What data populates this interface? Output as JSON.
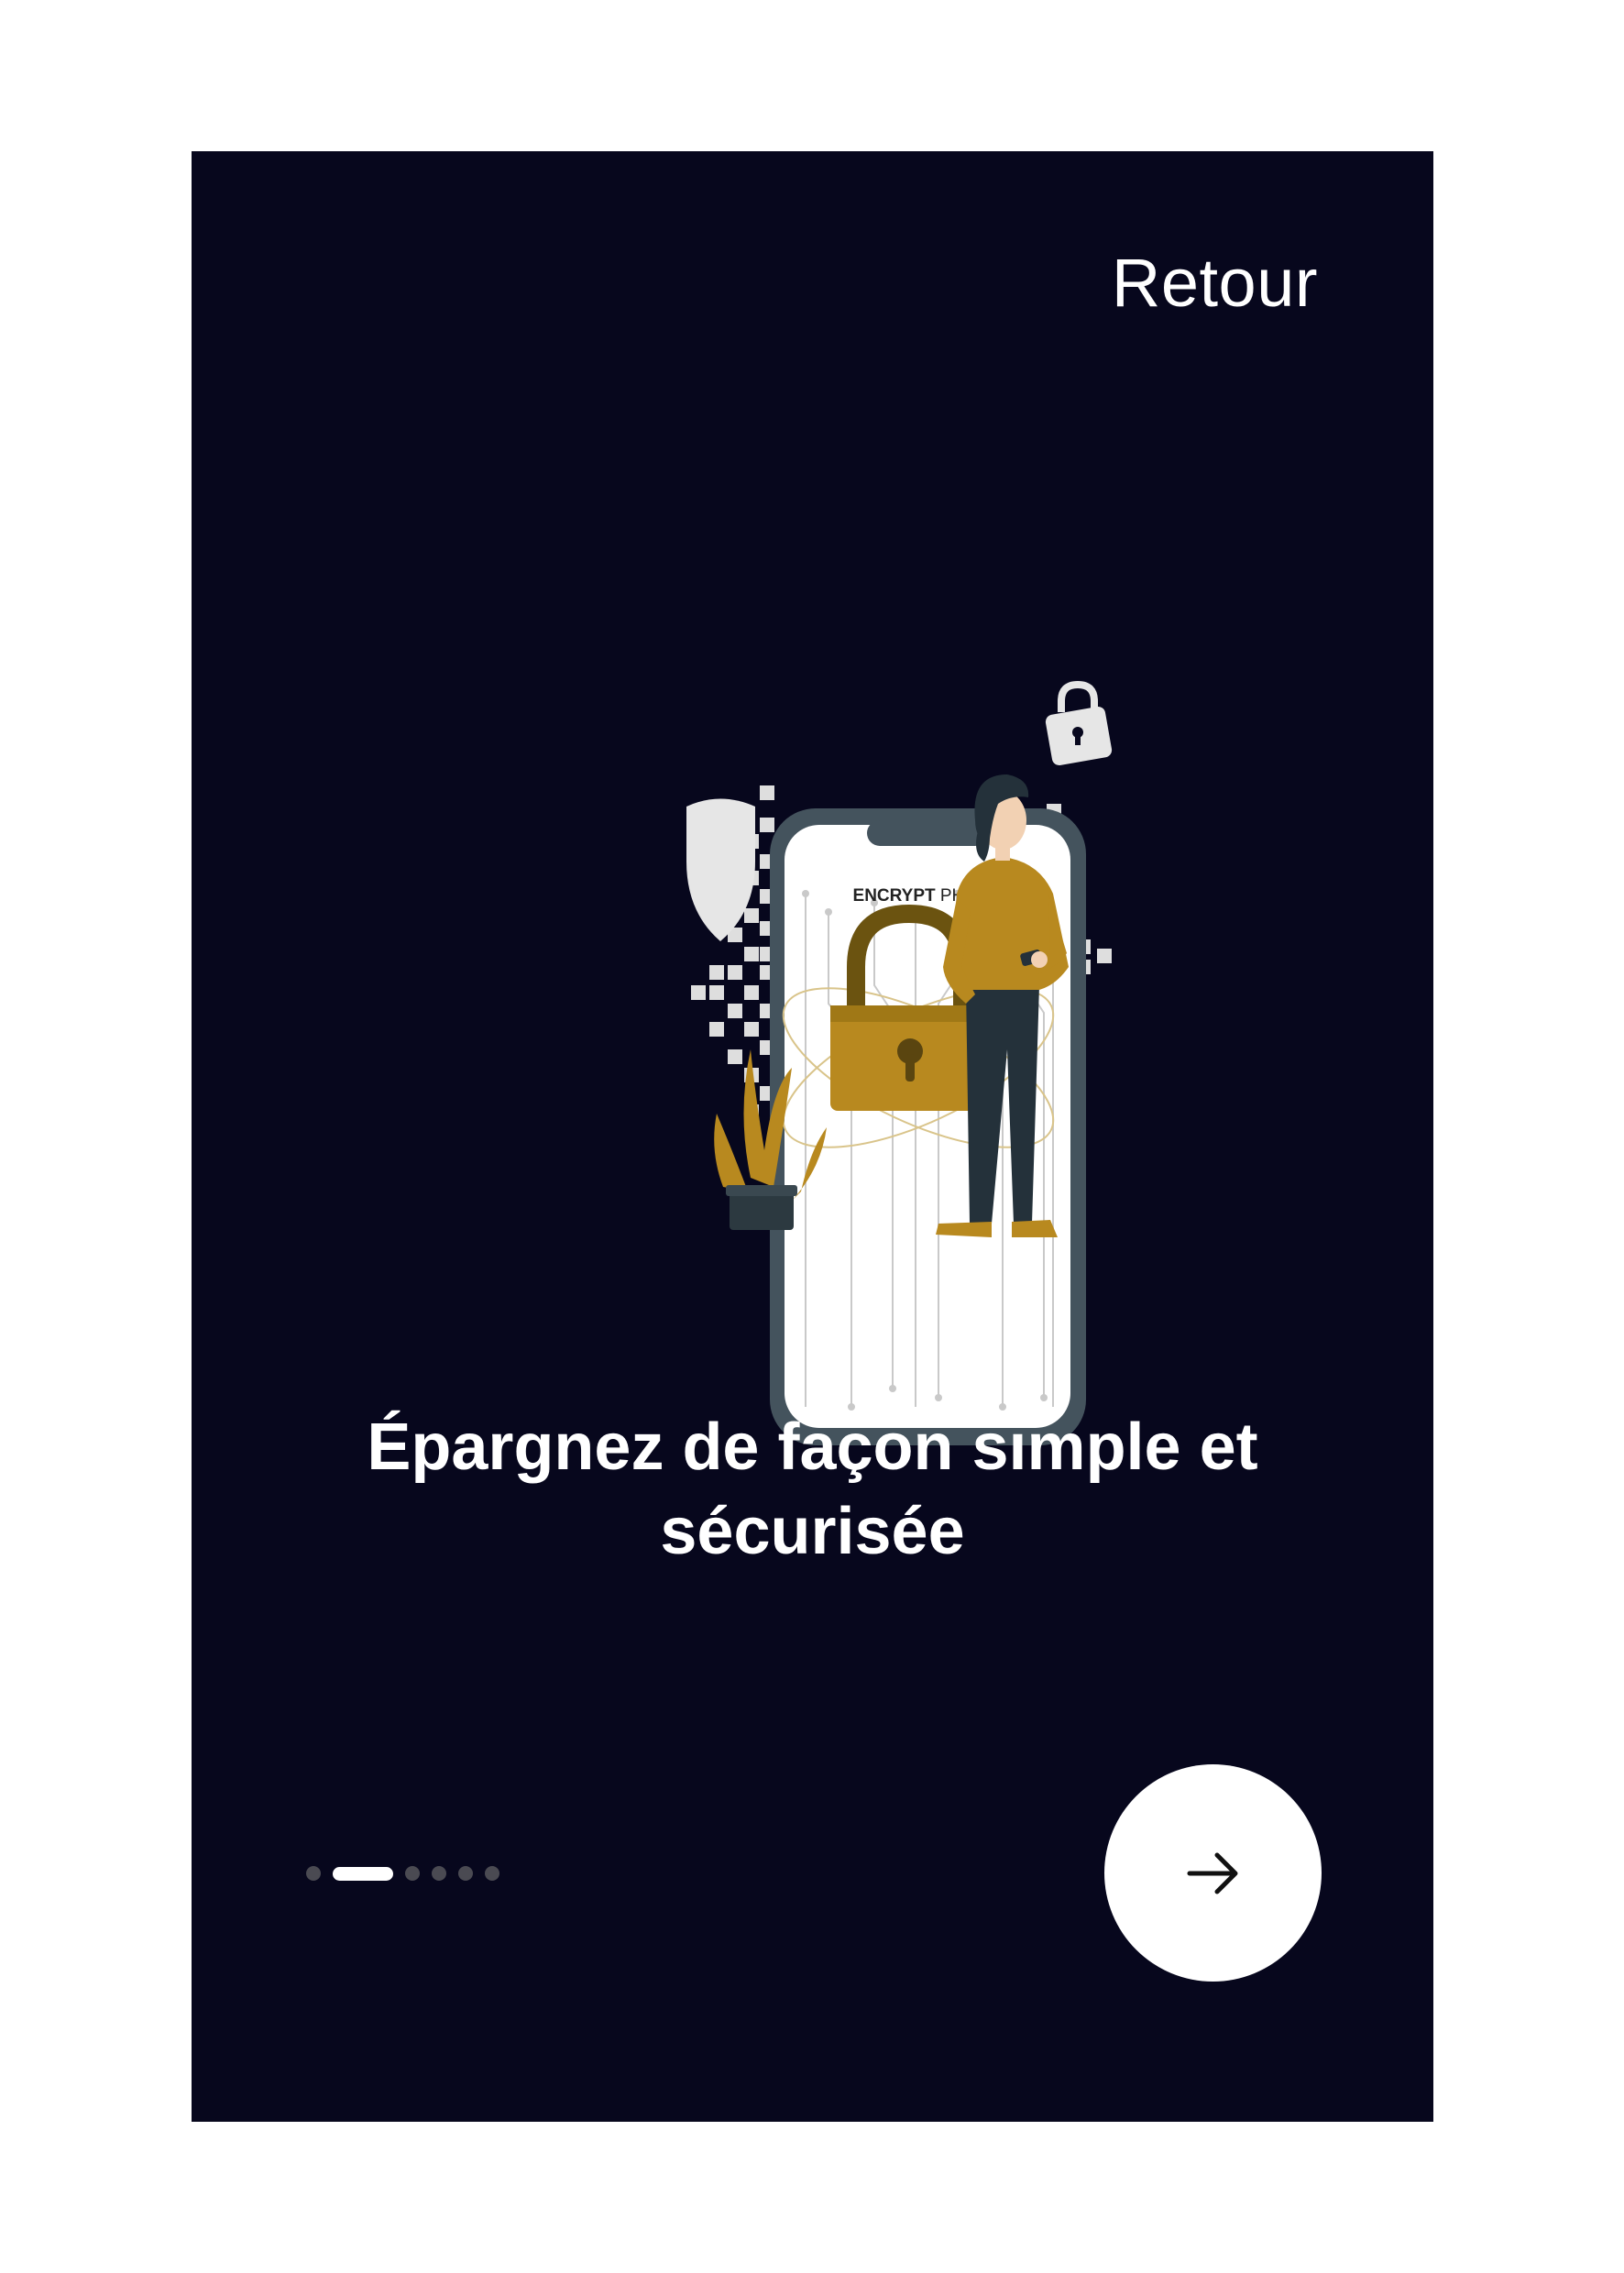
{
  "header": {
    "back_label": "Retour"
  },
  "illustration": {
    "phone_label_bold": "ENCRYPT",
    "phone_label_light": " PHONE"
  },
  "main": {
    "headline": "Épargnez de façon simple et sécurisée"
  },
  "pager": {
    "total": 6,
    "active_index": 1
  },
  "icons": {
    "next": "arrow-right-icon",
    "shield": "shield-icon",
    "padlock": "padlock-icon",
    "small_lock": "small-lock-icon"
  },
  "colors": {
    "background": "#07071d",
    "accent_gold": "#b8891f",
    "text": "#ffffff"
  }
}
